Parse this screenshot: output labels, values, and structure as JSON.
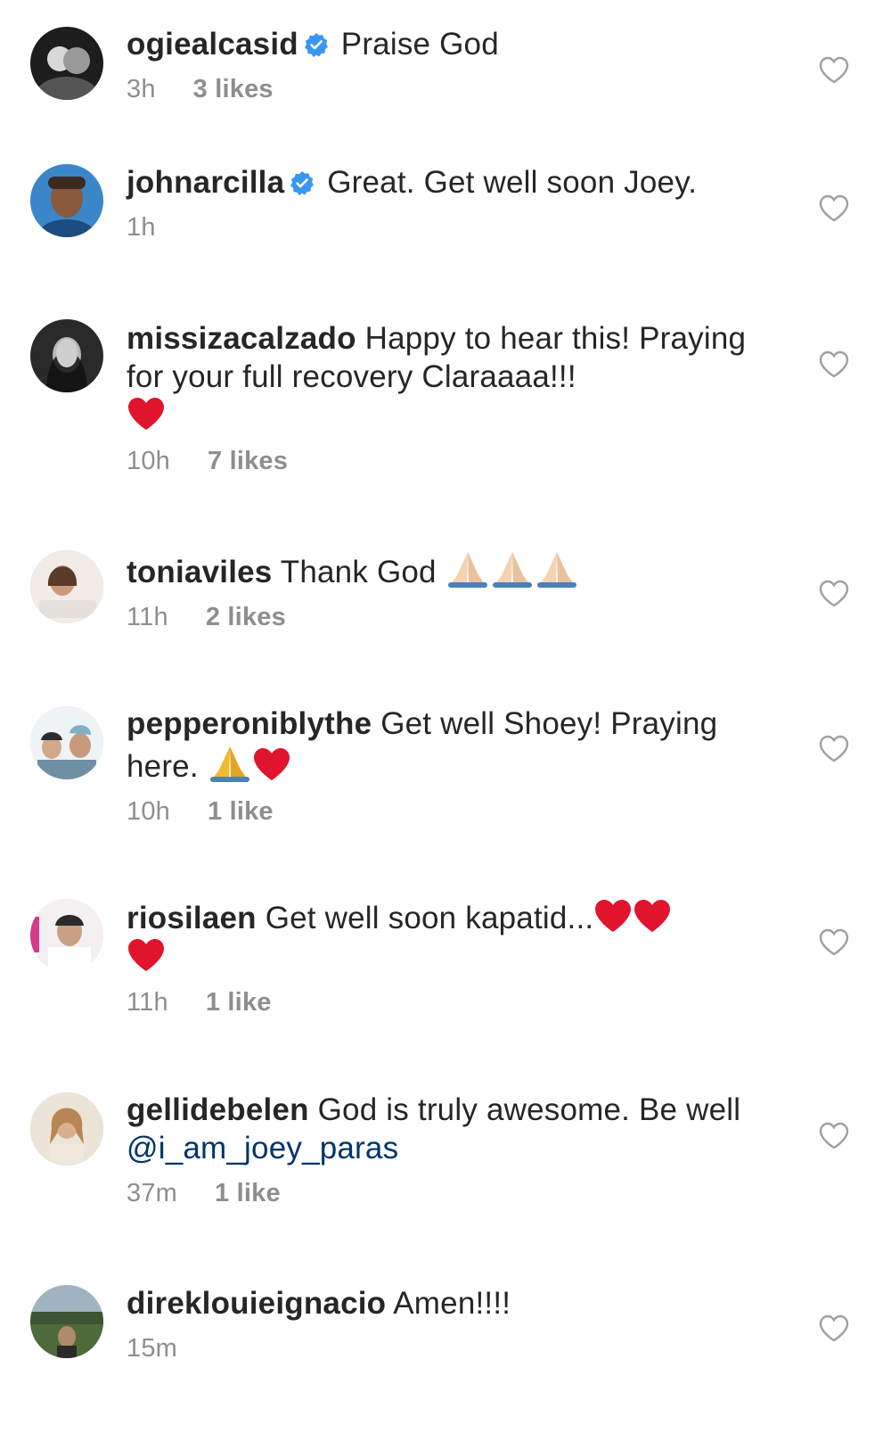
{
  "comments": [
    {
      "username": "ogiealcasid",
      "verified": true,
      "text": "Praise God",
      "time": "3h",
      "likes": "3 likes"
    },
    {
      "username": "johnarcilla",
      "verified": true,
      "text": "Great. Get well soon Joey.",
      "time": "1h",
      "likes": ""
    },
    {
      "username": "missizacalzado",
      "verified": false,
      "text": "Happy to hear this! Praying for your full recovery Claraaaa!!!",
      "time": "10h",
      "likes": "7 likes"
    },
    {
      "username": "toniaviles",
      "verified": false,
      "text": "Thank God",
      "time": "11h",
      "likes": "2 likes"
    },
    {
      "username": "pepperoniblythe",
      "verified": false,
      "text": "Get well Shoey! Praying here.",
      "time": "10h",
      "likes": "1 like"
    },
    {
      "username": "riosilaen",
      "verified": false,
      "text": "Get well soon kapatid...",
      "time": "11h",
      "likes": "1 like"
    },
    {
      "username": "gellidebelen",
      "verified": false,
      "text": "God is truly awesome. Be well",
      "mention": "@i_am_joey_paras",
      "time": "37m",
      "likes": "1 like"
    },
    {
      "username": "direklouieignacio",
      "verified": false,
      "text": "Amen!!!!",
      "time": "15m",
      "likes": ""
    }
  ],
  "icons": {
    "verified": "verified-badge-icon",
    "like": "heart-outline-icon",
    "emoji_heart": "red-heart-emoji",
    "emoji_pray": "folded-hands-emoji"
  },
  "colors": {
    "username": "#262626",
    "meta": "#8e8e8e",
    "verified": "#3897f0",
    "mention": "#003569",
    "heart_emoji": "#e0142c"
  }
}
